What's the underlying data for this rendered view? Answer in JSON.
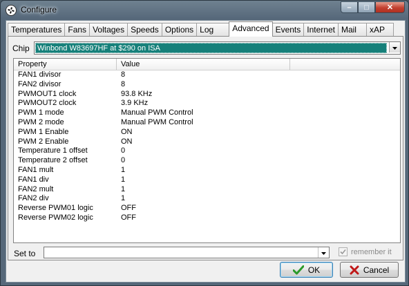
{
  "window": {
    "title": "Configure"
  },
  "caption": {
    "minimize": "–",
    "maximize": "□",
    "close": "✕"
  },
  "tabs": [
    {
      "label": "Temperatures",
      "active": false
    },
    {
      "label": "Fans",
      "active": false
    },
    {
      "label": "Voltages",
      "active": false
    },
    {
      "label": "Speeds",
      "active": false
    },
    {
      "label": "Options",
      "active": false
    },
    {
      "label": "Log",
      "active": false
    },
    {
      "label": "Advanced",
      "active": true
    },
    {
      "label": "Events",
      "active": false
    },
    {
      "label": "Internet",
      "active": false
    },
    {
      "label": "Mail",
      "active": false
    },
    {
      "label": "xAP",
      "active": false
    }
  ],
  "chip": {
    "label": "Chip",
    "value": "Winbond W83697HF at $290 on ISA"
  },
  "grid": {
    "headers": {
      "property": "Property",
      "value": "Value",
      "extra": ""
    },
    "rows": [
      {
        "property": "FAN1 divisor",
        "value": "8"
      },
      {
        "property": "FAN2 divisor",
        "value": "8"
      },
      {
        "property": "PWMOUT1 clock",
        "value": "93.8 KHz"
      },
      {
        "property": "PWMOUT2 clock",
        "value": "3.9 KHz"
      },
      {
        "property": "PWM 1 mode",
        "value": "Manual PWM Control"
      },
      {
        "property": "PWM 2 mode",
        "value": "Manual PWM Control"
      },
      {
        "property": "PWM 1 Enable",
        "value": "ON"
      },
      {
        "property": "PWM 2 Enable",
        "value": "ON"
      },
      {
        "property": "Temperature 1 offset",
        "value": "0"
      },
      {
        "property": "Temperature 2 offset",
        "value": "0"
      },
      {
        "property": "FAN1 mult",
        "value": "1"
      },
      {
        "property": "FAN1 div",
        "value": "1"
      },
      {
        "property": "FAN2 mult",
        "value": "1"
      },
      {
        "property": "FAN2 div",
        "value": "1"
      },
      {
        "property": "Reverse PWM01 logic",
        "value": "OFF"
      },
      {
        "property": "Reverse PWM02 logic",
        "value": "OFF"
      }
    ]
  },
  "setto": {
    "label": "Set to",
    "value": ""
  },
  "remember": {
    "label": "remember it",
    "checked": true
  },
  "buttons": {
    "ok": "OK",
    "cancel": "Cancel"
  },
  "colors": {
    "selection": "#16807a",
    "ok_check": "#2a9a2a",
    "cancel_x": "#c01818"
  }
}
